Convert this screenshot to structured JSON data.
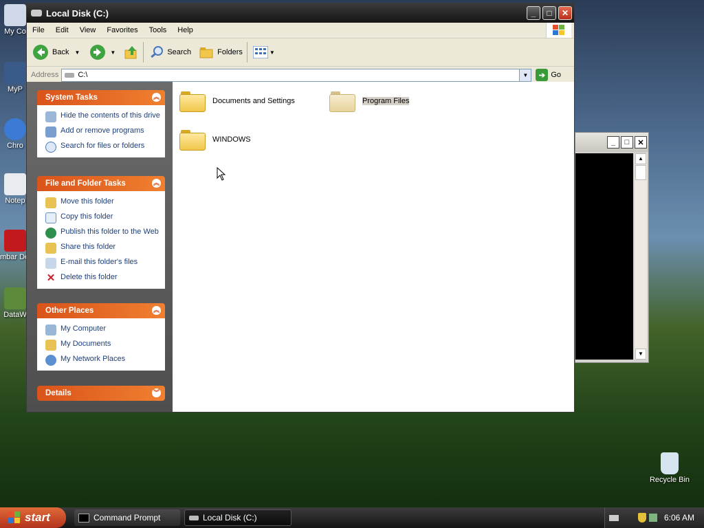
{
  "desktop": {
    "icons": [
      {
        "label": "My Co"
      },
      {
        "label": "MyP"
      },
      {
        "label": "Chro"
      },
      {
        "label": "Notep"
      },
      {
        "label": "Embar Dev-"
      },
      {
        "label": "DataW"
      }
    ],
    "recycle_bin_label": "Recycle Bin"
  },
  "window": {
    "title": "Local Disk (C:)",
    "menu": [
      "File",
      "Edit",
      "View",
      "Favorites",
      "Tools",
      "Help"
    ],
    "toolbar": {
      "back_label": "Back",
      "search_label": "Search",
      "folders_label": "Folders"
    },
    "address": {
      "label": "Address",
      "value": "C:\\",
      "go_label": "Go"
    },
    "panels": {
      "system_tasks": {
        "title": "System Tasks",
        "items": [
          "Hide the contents of this drive",
          "Add or remove programs",
          "Search for files or folders"
        ]
      },
      "file_folder_tasks": {
        "title": "File and Folder Tasks",
        "items": [
          "Move this folder",
          "Copy this folder",
          "Publish this folder to the Web",
          "Share this folder",
          "E-mail this folder's files",
          "Delete this folder"
        ]
      },
      "other_places": {
        "title": "Other Places",
        "items": [
          "My Computer",
          "My Documents",
          "My Network Places"
        ]
      },
      "details": {
        "title": "Details"
      }
    },
    "files": [
      "Documents and Settings",
      "Program Files",
      "WINDOWS"
    ]
  },
  "taskbar": {
    "start_label": "start",
    "tasks": [
      "Command Prompt",
      "Local Disk (C:)"
    ],
    "clock": "6:06 AM"
  },
  "colors": {
    "panel_header": "#e8672a",
    "link_text": "#1e3f7a",
    "titlebar": "#1f1f1f",
    "start_button": "#c9452a"
  }
}
